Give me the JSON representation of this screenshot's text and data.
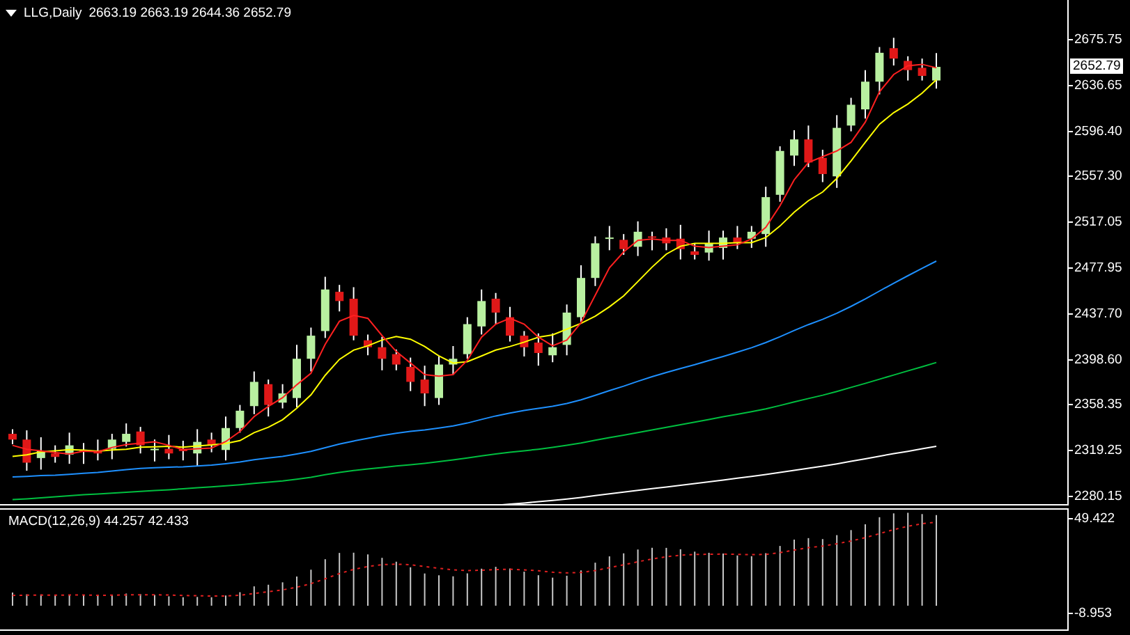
{
  "header": {
    "symbol": "LLG,Daily",
    "ohlc": "2663.19 2663.19 2644.36 2652.79"
  },
  "price_axis": {
    "ticks": [
      "2675.75",
      "2636.65",
      "2596.40",
      "2557.30",
      "2517.05",
      "2477.95",
      "2437.70",
      "2398.60",
      "2358.35",
      "2319.25",
      "2280.15"
    ],
    "current_price": "2652.79"
  },
  "macd": {
    "label": "MACD(12,26,9) 44.257 42.433",
    "axis_ticks": [
      "49.422",
      "-8.953"
    ]
  }
}
